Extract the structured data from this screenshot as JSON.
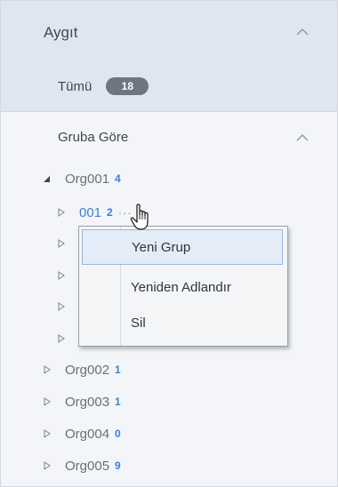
{
  "device_section": {
    "title": "Aygıt",
    "all_label": "Tümü",
    "all_count": "18"
  },
  "group_section": {
    "title": "Gruba Göre"
  },
  "tree": {
    "root": {
      "label": "Org001",
      "count": "4"
    },
    "child_active": {
      "label": "001",
      "count": "2",
      "dots": "···"
    },
    "orgs": [
      {
        "label": "Org002",
        "count": "1"
      },
      {
        "label": "Org003",
        "count": "1"
      },
      {
        "label": "Org004",
        "count": "0"
      },
      {
        "label": "Org005",
        "count": "9"
      }
    ]
  },
  "context_menu": {
    "items": [
      "Yeni Grup",
      "Yeniden Adlandır",
      "Sil"
    ]
  },
  "icons": {
    "collapse": "chevron-up-icon",
    "expanded": "triangle-down-icon",
    "collapsed": "triangle-right-icon",
    "cursor": "hand-pointer-icon"
  },
  "colors": {
    "accent": "#3b7fd9",
    "badge": "#6f7680",
    "header_bg": "#dfe6ef"
  }
}
